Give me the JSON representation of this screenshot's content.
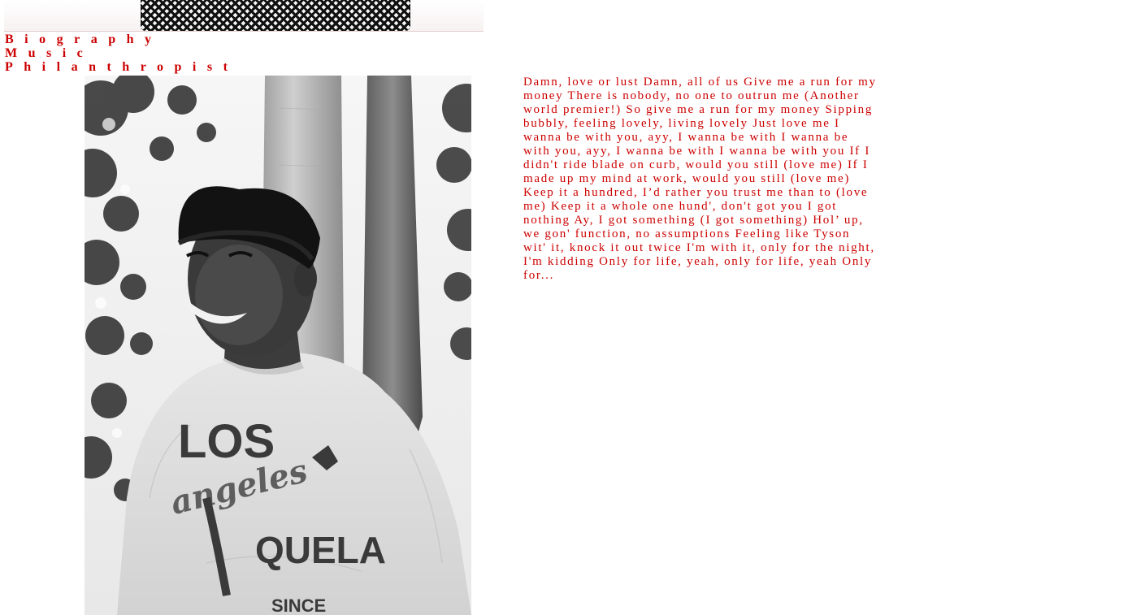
{
  "nav": {
    "items": [
      {
        "label": "Biography"
      },
      {
        "label": "Music"
      },
      {
        "label": "Philanthropist"
      }
    ]
  },
  "lyrics": {
    "text": "Damn, love or lust Damn, all of us Give me a run for my money There is nobody, no one to outrun me (Another world premier!) So give me a run for my money Sipping bubbly, feeling lovely, living lovely Just love me I wanna be with you, ayy, I wanna be with I wanna be with you, ayy, I wanna be with I wanna be with you If I didn't ride blade on curb, would you still (love me) If I made up my mind at work, would you still (love me) Keep it a hundred, I’d rather you trust me than to (love me) Keep it a whole one hund', don't got you I got nothing Ay, I got something (I got something) Hol’ up, we gon' function, no assumptions Feeling like Tyson wit' it, knock it out twice I'm with it, only for the night, I'm kidding Only for life, yeah, only for life, yeah Only for..."
  },
  "photo": {
    "shirt_text_top": "LOS",
    "shirt_text_script": "angeles",
    "shirt_text_middle": "QUELA",
    "shirt_text_bottom": "SINCE"
  },
  "colors": {
    "accent": "#cc0000",
    "background": "#ffffff"
  }
}
